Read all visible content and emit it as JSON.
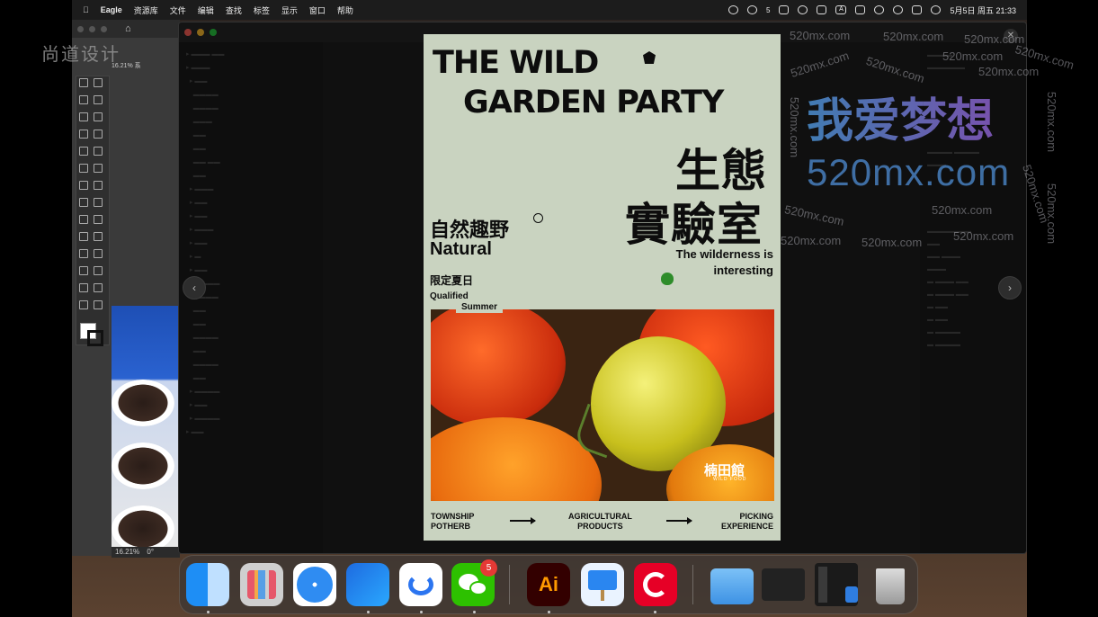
{
  "menubar": {
    "app_name": "Eagle",
    "menus": [
      "资源库",
      "文件",
      "编辑",
      "查找",
      "标签",
      "显示",
      "窗口",
      "帮助"
    ],
    "wechat_count": "5",
    "input_indicator": "A",
    "clock": "5月5日 周五 21:33"
  },
  "illustrator": {
    "watermark_brand": "尚道设计",
    "doc_tab": "16.21% 系",
    "status_zoom": "16.21%",
    "status_angle": "0°"
  },
  "poster": {
    "title_line1": "THE WILD",
    "title_line2": "GARDEN PARTY",
    "cn_title_line1": "生態",
    "cn_title_line2": "實驗室",
    "natural_cn": "自然趣野",
    "natural_en": "Natural",
    "wilderness_line1": "The wilderness is",
    "wilderness_line2": "interesting",
    "limited_summer_cn": "限定夏日",
    "qualified": "Qualified",
    "summer": "Summer",
    "logo_cn": "楠田館",
    "logo_en": "WILD FOOD",
    "footer": [
      {
        "line1": "TOWNSHIP",
        "line2": "POTHERB"
      },
      {
        "line1": "AGRICULTURAL",
        "line2": "PRODUCTS"
      },
      {
        "line1": "PICKING",
        "line2": "EXPERIENCE"
      }
    ]
  },
  "watermark": {
    "big_cn": "我爱梦想",
    "big_domain": "520mx.com",
    "small": "520mx.com"
  },
  "dock": {
    "apps": [
      "finder",
      "launchpad",
      "safari",
      "feishu",
      "lark-docs",
      "wechat",
      "illustrator",
      "keynote",
      "netease-music",
      "folder",
      "screen-recorder",
      "downloads-stack",
      "trash"
    ],
    "wechat_badge": "5",
    "illustrator_label": "Ai"
  }
}
